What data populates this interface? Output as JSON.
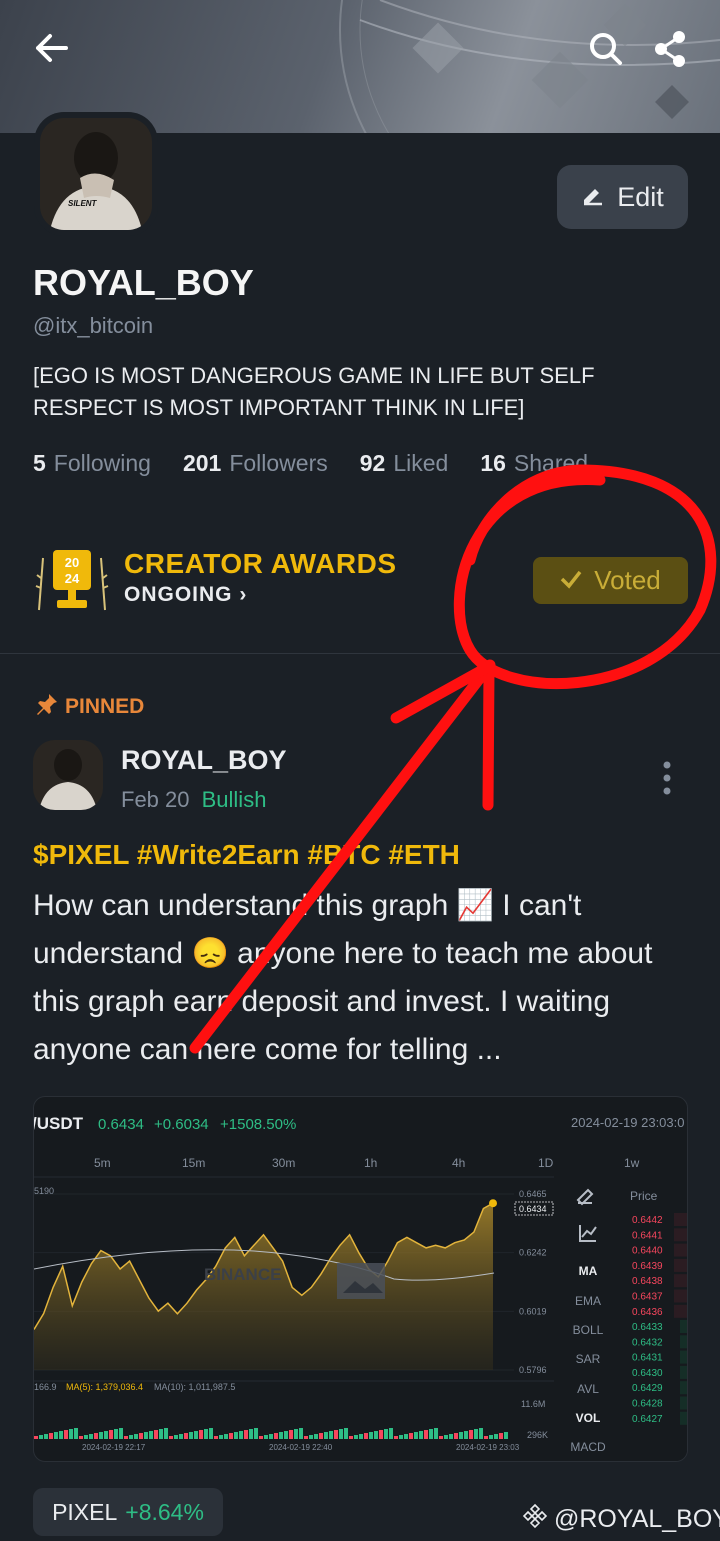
{
  "header": {
    "back_icon": "arrow-left-icon",
    "search_icon": "search-icon",
    "share_icon": "share-icon"
  },
  "profile": {
    "avatar_text": "SILENT",
    "edit_label": "Edit",
    "display_name": "ROYAL_BOY",
    "handle": "@itx_bitcoin",
    "bio": "[EGO IS MOST DANGEROUS GAME IN LIFE BUT SELF RESPECT IS MOST IMPORTANT THINK IN LIFE]",
    "stats": [
      {
        "count": "5",
        "label": "Following"
      },
      {
        "count": "201",
        "label": "Followers"
      },
      {
        "count": "92",
        "label": "Liked"
      },
      {
        "count": "16",
        "label": "Shared"
      }
    ]
  },
  "awards": {
    "trophy_year": "2024",
    "title": "CREATOR AWARDS",
    "status": "ONGOING",
    "voted_label": "Voted"
  },
  "post": {
    "pinned_label": "PINNED",
    "author": "ROYAL_BOY",
    "date": "Feb 20",
    "sentiment": "Bullish",
    "tags": "$PIXEL #Write2Earn #BTC #ETH",
    "text": "How can understand this graph 📈 I can't understand 😞 anyone here to teach me about this graph earn deposit and  invest. I waiting anyone can here come for telling ...",
    "token_symbol": "PIXEL",
    "token_change": "+8.64%"
  },
  "chart_card": {
    "pair": "/USDT",
    "price": "0.6434",
    "change": "+0.6034",
    "change_pct": "+1508.50%",
    "datetime": "2024-02-19 23:03:0",
    "intervals": [
      "5m",
      "15m",
      "30m",
      "1h",
      "4h",
      "1D",
      "1w"
    ],
    "left_label": "5190",
    "price_labels": [
      "0.6465",
      "0.6242",
      "0.6019",
      "0.5796"
    ],
    "current_price_tag": "0.6434",
    "watermark": "BINANCE",
    "volume_info": {
      "v": "166.9",
      "ma5": "MA(5): 1,379,036.4",
      "ma10": "MA(10): 1,011,987.5"
    },
    "volume_labels": [
      "11.6M",
      "296K"
    ],
    "time_labels": [
      "2024-02-19 22:17",
      "2024-02-19 22:40",
      "2024-02-19 23:03"
    ],
    "indicators": [
      "MA",
      "EMA",
      "BOLL",
      "SAR",
      "AVL",
      "VOL",
      "MACD"
    ],
    "orderbook_header": "Price",
    "asks": [
      "0.6442",
      "0.6441",
      "0.6440",
      "0.6439",
      "0.6438",
      "0.6437",
      "0.6436"
    ],
    "bids": [
      "0.6433",
      "0.6432",
      "0.6431",
      "0.6430",
      "0.6429",
      "0.6428",
      "0.6427"
    ],
    "line_values": [
      0.595,
      0.601,
      0.611,
      0.619,
      0.604,
      0.613,
      0.62,
      0.625,
      0.623,
      0.618,
      0.621,
      0.614,
      0.607,
      0.602,
      0.605,
      0.601,
      0.605,
      0.61,
      0.614,
      0.619,
      0.626,
      0.63,
      0.623,
      0.627,
      0.631,
      0.626,
      0.621,
      0.611,
      0.608,
      0.611,
      0.616,
      0.622,
      0.627,
      0.631,
      0.624,
      0.618,
      0.615,
      0.621,
      0.628,
      0.63,
      0.628,
      0.626,
      0.627,
      0.626,
      0.628,
      0.629,
      0.632,
      0.641,
      0.643
    ]
  },
  "watermark": {
    "logo_icon": "binance-logo-icon",
    "text": "@ROYAL_BOY"
  },
  "colors": {
    "background": "#1b2026",
    "accent": "#f0b90b",
    "positive": "#2ebd85",
    "negative": "#f6465d",
    "annotation": "#ff1010"
  }
}
